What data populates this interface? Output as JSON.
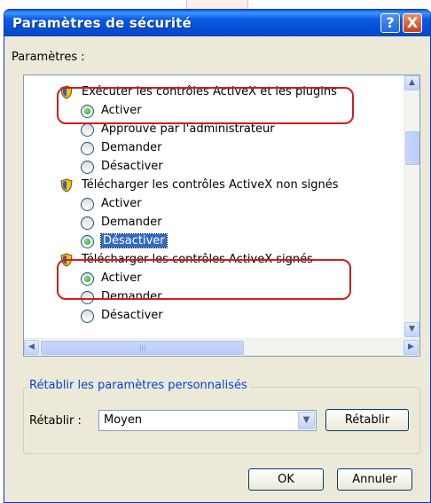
{
  "dialog": {
    "title": "Paramètres de sécurité",
    "help_button": "?",
    "close_button": "X"
  },
  "settings": {
    "label": "Paramètres :",
    "items": [
      {
        "kind": "group",
        "text": "Exécuter les contrôles ActiveX et les plugins"
      },
      {
        "kind": "option",
        "text": "Activer",
        "checked": true
      },
      {
        "kind": "option",
        "text": "Approuvé par l'administrateur",
        "checked": false
      },
      {
        "kind": "option",
        "text": "Demander",
        "checked": false
      },
      {
        "kind": "option",
        "text": "Désactiver",
        "checked": false
      },
      {
        "kind": "group",
        "text": "Télécharger les contrôles ActiveX non signés"
      },
      {
        "kind": "option",
        "text": "Activer",
        "checked": false
      },
      {
        "kind": "option",
        "text": "Demander",
        "checked": false
      },
      {
        "kind": "option",
        "text": "Désactiver",
        "checked": true,
        "selected": true
      },
      {
        "kind": "group",
        "text": "Télécharger les contrôles ActiveX signés"
      },
      {
        "kind": "option",
        "text": "Activer",
        "checked": true
      },
      {
        "kind": "option",
        "text": "Demander",
        "checked": false
      },
      {
        "kind": "option",
        "text": "Désactiver",
        "checked": false
      }
    ]
  },
  "reset": {
    "group_label": "Rétablir les paramètres personnalisés",
    "label": "Rétablir :",
    "level": "Moyen",
    "button": "Rétablir"
  },
  "footer": {
    "ok": "OK",
    "cancel": "Annuler"
  },
  "colors": {
    "titlebar": "#0a5fdc",
    "selection": "#316ac5",
    "annotation": "#d11f1f",
    "radio_checked": "#21a121"
  }
}
